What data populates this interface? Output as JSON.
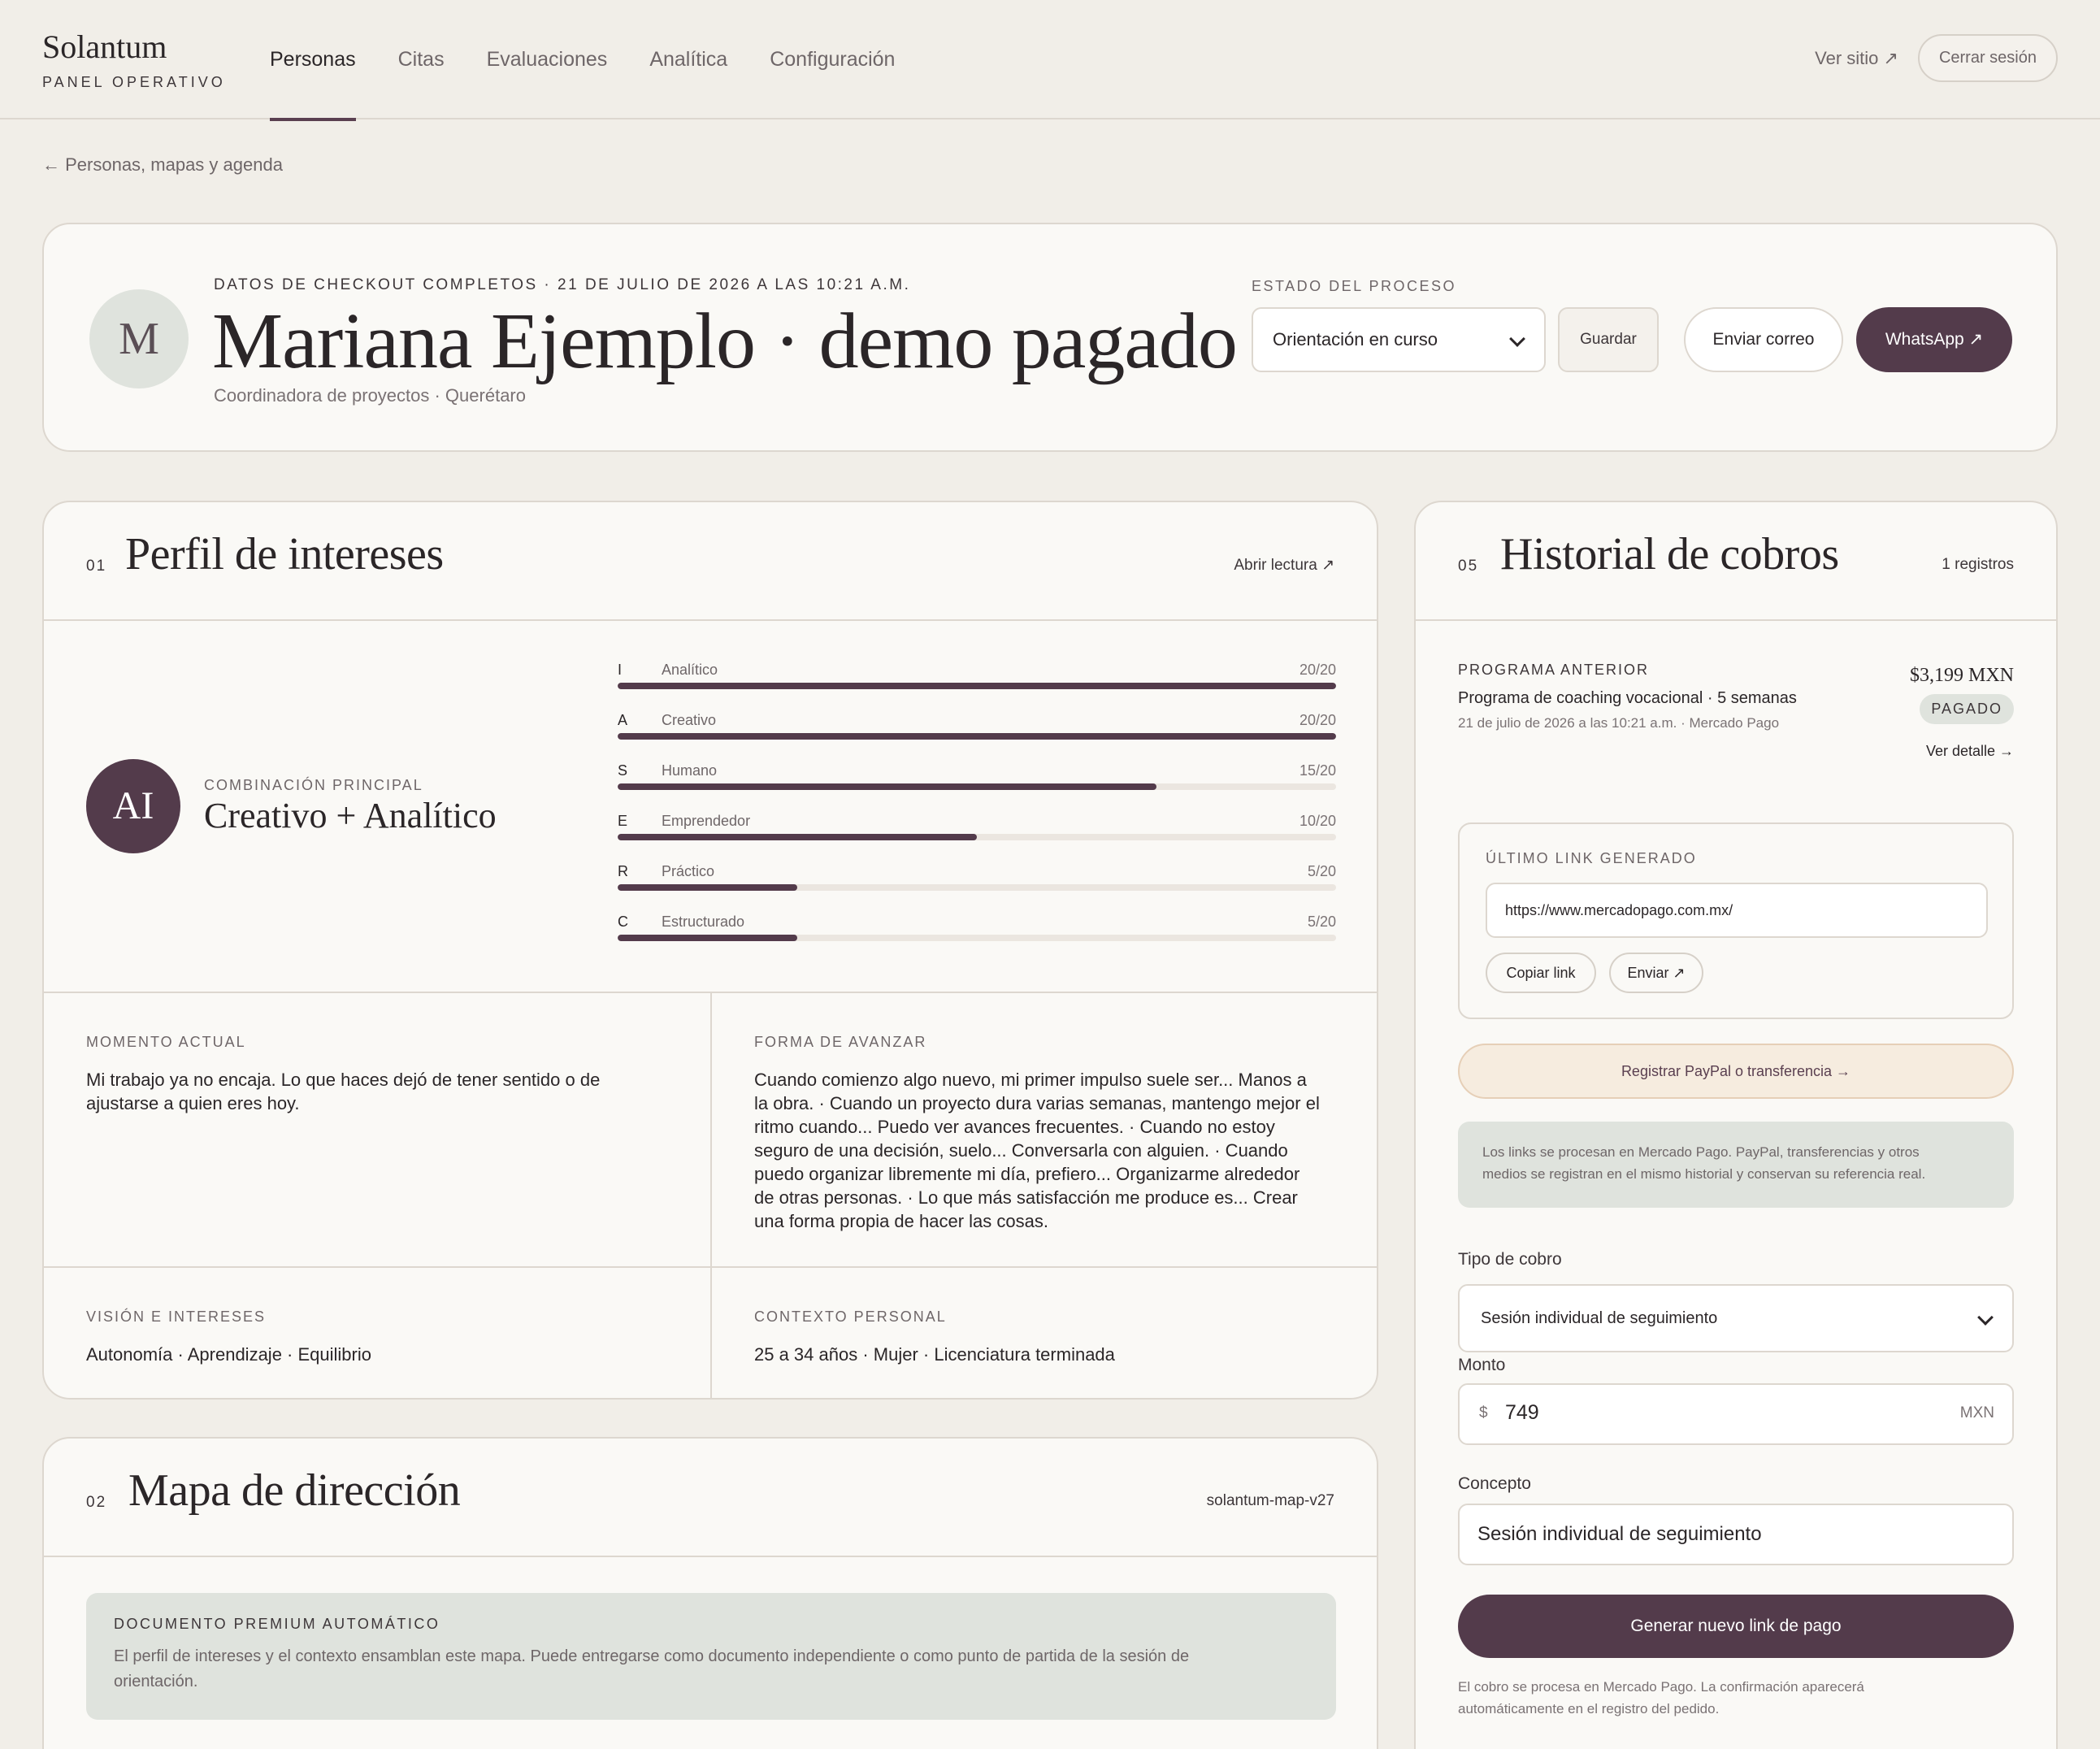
{
  "brand": {
    "name": "Solantum",
    "subtitle": "PANEL OPERATIVO"
  },
  "nav": {
    "items": [
      {
        "label": "Personas",
        "active": true
      },
      {
        "label": "Citas"
      },
      {
        "label": "Evaluaciones"
      },
      {
        "label": "Analítica"
      },
      {
        "label": "Configuración"
      }
    ],
    "ver_sitio": "Ver sitio ↗",
    "logout": "Cerrar sesión"
  },
  "backlink": "← Personas, mapas y agenda",
  "person": {
    "initial": "M",
    "meta": "DATOS DE CHECKOUT COMPLETOS · 21 DE JULIO DE 2026 A LAS 10:21 A.M.",
    "name": "Mariana Ejemplo · demo pagado",
    "subtitle": "Coordinadora de proyectos · Querétaro"
  },
  "estado": {
    "label": "ESTADO DEL PROCESO",
    "value": "Orientación en curso",
    "save": "Guardar",
    "email": "Enviar correo",
    "whatsapp": "WhatsApp ↗"
  },
  "perfil": {
    "num": "01",
    "title": "Perfil de intereses",
    "action": "Abrir lectura ↗",
    "initials": "AI",
    "comb_label": "COMBINACIÓN PRINCIPAL",
    "comb_value": "Creativo + Analítico",
    "scores": [
      {
        "letter": "I",
        "name": "Analítico",
        "score": "20/20",
        "fraction": 1.0
      },
      {
        "letter": "A",
        "name": "Creativo",
        "score": "20/20",
        "fraction": 1.0
      },
      {
        "letter": "S",
        "name": "Humano",
        "score": "15/20",
        "fraction": 0.75
      },
      {
        "letter": "E",
        "name": "Emprendedor",
        "score": "10/20",
        "fraction": 0.5
      },
      {
        "letter": "R",
        "name": "Práctico",
        "score": "5/20",
        "fraction": 0.25
      },
      {
        "letter": "C",
        "name": "Estructurado",
        "score": "5/20",
        "fraction": 0.25
      }
    ],
    "momento": {
      "label": "MOMENTO ACTUAL",
      "line1": "Mi trabajo ya no encaja. Lo que haces dejó de tener sentido o de",
      "line2": "ajustarse a quien eres hoy."
    },
    "forma": {
      "label": "FORMA DE AVANZAR",
      "lines": [
        "Cuando comienzo algo nuevo, mi primer impulso suele ser... Manos a",
        "la obra. · Cuando un proyecto dura varias semanas, mantengo mejor el",
        "ritmo cuando... Puedo ver avances frecuentes. · Cuando no estoy",
        "seguro de una decisión, suelo... Conversarla con alguien. · Cuando",
        "puedo organizar libremente mi día, prefiero... Organizarme alrededor",
        "de otras personas. · Lo que más satisfacción me produce es... Crear",
        "una forma propia de hacer las cosas."
      ]
    },
    "vision": {
      "label": "VISIÓN E INTERESES",
      "text": "Autonomía · Aprendizaje · Equilibrio"
    },
    "contexto": {
      "label": "CONTEXTO PERSONAL",
      "text": "25 a 34 años · Mujer · Licenciatura terminada"
    }
  },
  "mapa": {
    "num": "02",
    "title": "Mapa de dirección",
    "version": "solantum-map-v27",
    "box_label": "DOCUMENTO PREMIUM AUTOMÁTICO",
    "box_line1": "El perfil de intereses y el contexto ensamblan este mapa. Puede entregarse como documento independiente o como punto de partida de la sesión de",
    "box_line2": "orientación."
  },
  "historial": {
    "num": "05",
    "title": "Historial de cobros",
    "count": "1 registros",
    "programa": {
      "label": "PROGRAMA ANTERIOR",
      "title": "Programa de coaching vocacional · 5 semanas",
      "date": "21 de julio de 2026 a las 10:21 a.m. · Mercado Pago",
      "amount": "$3,199 MXN",
      "status": "PAGADO",
      "detail": "Ver detalle →"
    },
    "link": {
      "label": "ÚLTIMO LINK GENERADO",
      "url": "https://www.mercadopago.com.mx/",
      "copy": "Copiar link",
      "send": "Enviar ↗"
    },
    "paypal": "Registrar PayPal o transferencia →",
    "note_line1": "Los links se procesan en Mercado Pago. PayPal, transferencias y otros",
    "note_line2": "medios se registran en el mismo historial y conservan su referencia real.",
    "form": {
      "tipo_label": "Tipo de cobro",
      "tipo_value": "Sesión individual de seguimiento",
      "monto_label": "Monto",
      "currency_symbol": "$",
      "monto_value": "749",
      "monto_unit": "MXN",
      "concepto_label": "Concepto",
      "concepto_value": "Sesión individual de seguimiento",
      "submit": "Generar nuevo link de pago",
      "footer_line1": "El cobro se procesa en Mercado Pago. La confirmación aparecerá",
      "footer_line2": "automáticamente en el registro del pedido."
    }
  }
}
